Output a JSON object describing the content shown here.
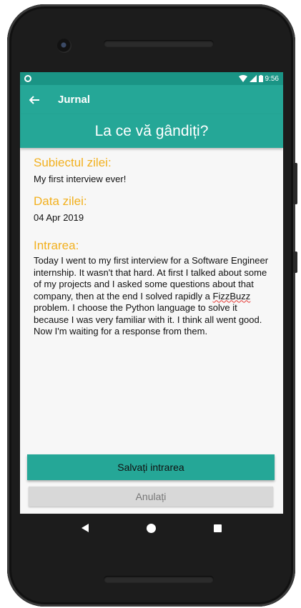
{
  "status_bar": {
    "time": "9:56"
  },
  "toolbar": {
    "title": "Jurnal"
  },
  "header": {
    "prompt": "La ce vă gândiți?"
  },
  "entry": {
    "subject_label": "Subiectul zilei:",
    "subject_value": "My first interview ever!",
    "date_label": "Data zilei:",
    "date_value": "04 Apr 2019",
    "text_label": "Intrarea:",
    "text_before": "Today I went to my first interview for a Software Engineer internship. It wasn't that hard. At first I talked about some of my projects and I asked some questions about that company, then at the end I solved rapidly a ",
    "text_underlined": "FizzBuzz",
    "text_after": " problem. I choose the Python language to solve it because I was very familiar with it. I think all went good. Now I'm waiting for a response from them."
  },
  "buttons": {
    "save": "Salvați intrarea",
    "cancel": "Anulați"
  },
  "colors": {
    "primary": "#25a797",
    "primary_dark": "#1a9485",
    "accent": "#f2b01e",
    "cancel_bg": "#d8d8d8"
  },
  "icons": {
    "status_left": "notification-circle-icon",
    "wifi": "wifi-icon",
    "signal": "signal-icon",
    "battery": "battery-icon",
    "back": "arrow-back-icon"
  }
}
